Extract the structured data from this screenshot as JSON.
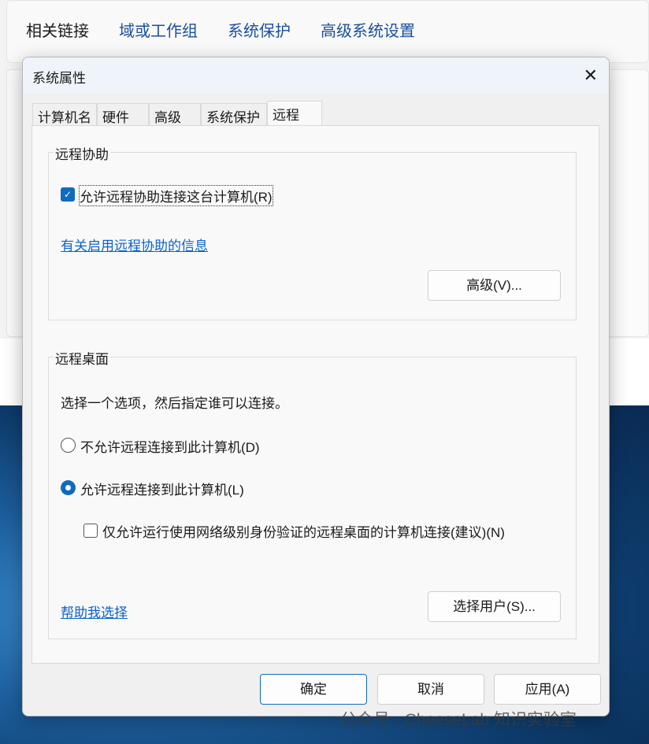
{
  "background": {
    "related_links": "相关链接",
    "links": [
      "域或工作组",
      "系统保护",
      "高级系统设置"
    ]
  },
  "dialog": {
    "title": "系统属性",
    "tabs": [
      "计算机名",
      "硬件",
      "高级",
      "系统保护",
      "远程"
    ],
    "active_tab": "远程",
    "remote_assistance": {
      "group_label": "远程协助",
      "allow_label": "允许远程协助连接这台计算机(R)",
      "allow_checked": true,
      "info_link": "有关启用远程协助的信息",
      "advanced_button": "高级(V)..."
    },
    "remote_desktop": {
      "group_label": "远程桌面",
      "instruction": "选择一个选项，然后指定谁可以连接。",
      "option_deny": "不允许远程连接到此计算机(D)",
      "option_allow": "允许远程连接到此计算机(L)",
      "selected": "option_allow",
      "nla_label": "仅允许运行使用网络级别身份验证的远程桌面的计算机连接(建议)(N)",
      "nla_checked": false,
      "help_link": "帮助我选择",
      "select_users_button": "选择用户(S)..."
    },
    "buttons": {
      "ok": "确定",
      "cancel": "取消",
      "apply": "应用(A)"
    }
  },
  "watermark": "公众号 · CheeseLab 知识实验室",
  "colors": {
    "accent": "#0f6cbd",
    "link": "#0b63c6"
  }
}
